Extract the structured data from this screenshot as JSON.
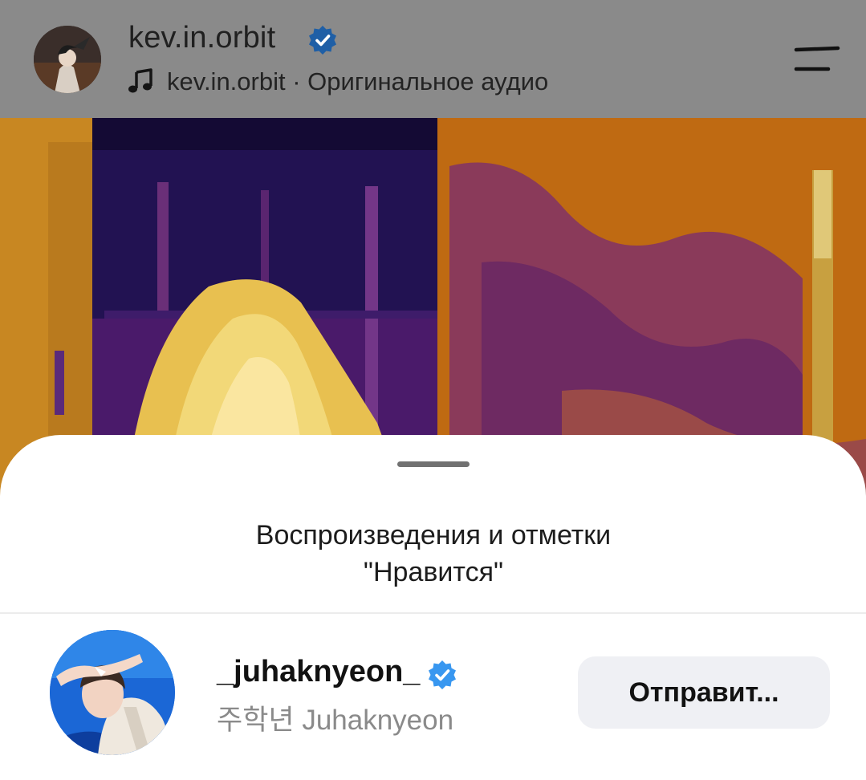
{
  "post_header": {
    "author_username": "kev.in.orbit",
    "audio_label": "kev.in.orbit · Оригинальное аудио"
  },
  "sheet": {
    "title": "Воспроизведения и отметки \"Нравится\"",
    "users": [
      {
        "username": "_juhaknyeon_",
        "verified": true,
        "full_name": "주학년 Juhaknyeon",
        "action_label": "Отправит..."
      }
    ]
  },
  "colors": {
    "verified_badge": "#3897f0",
    "sheet_background": "#ffffff",
    "button_background": "#eff0f4",
    "secondary_text": "#8a8a8a"
  },
  "icons": {
    "header_audio": "music-note-icon",
    "header_menu": "menu-icon",
    "verified": "verified-badge-icon"
  }
}
